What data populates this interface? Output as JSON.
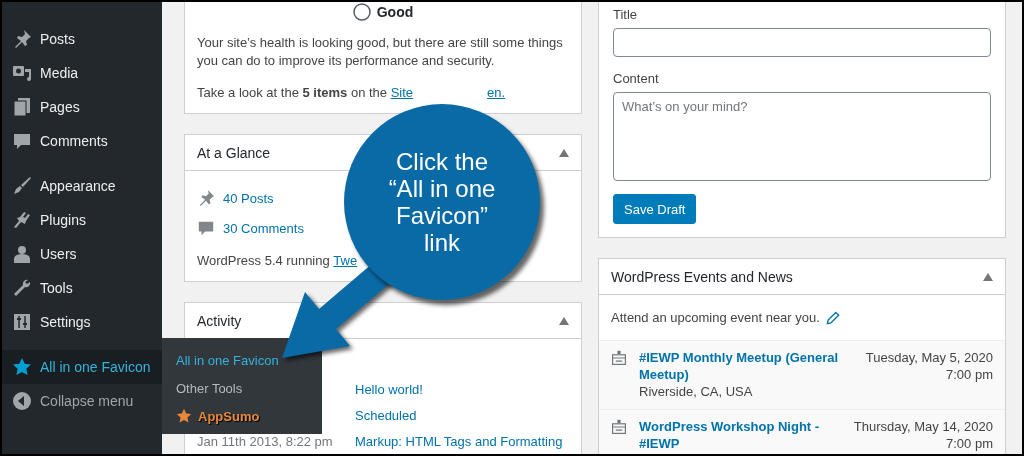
{
  "sidebar": {
    "groups": [
      {
        "items": [
          {
            "label": "Posts",
            "selected": false
          },
          {
            "label": "Media",
            "selected": false
          },
          {
            "label": "Pages",
            "selected": false
          },
          {
            "label": "Comments",
            "selected": false
          }
        ]
      },
      {
        "items": [
          {
            "label": "Appearance",
            "selected": false
          },
          {
            "label": "Plugins",
            "selected": false
          },
          {
            "label": "Users",
            "selected": false
          },
          {
            "label": "Tools",
            "selected": false
          },
          {
            "label": "Settings",
            "selected": false
          }
        ]
      },
      {
        "items": [
          {
            "label": "All in one Favicon",
            "selected": true
          }
        ]
      }
    ],
    "collapse": "Collapse menu"
  },
  "flyout": {
    "items": [
      {
        "label": "All in one Favicon",
        "kind": "current"
      },
      {
        "label": "Other Tools",
        "kind": "plain"
      },
      {
        "label": "AppSumo",
        "kind": "promo"
      }
    ]
  },
  "site_health": {
    "status": "Good",
    "message": "Your site’s health is looking good, but there are still some things you can do to improve its performance and security.",
    "tip": "Take a look at the **5 items** on the",
    "tip_link": "Site",
    "tip_end": "en."
  },
  "at_a_glance": {
    "title": "At a Glance",
    "expanded": true,
    "stats": [
      "40 Posts",
      "30 Comments"
    ],
    "version_text": "WordPress 5.4 running",
    "theme_link": "Twe"
  },
  "activity": {
    "title": "Activity",
    "expanded": true,
    "rows": [
      {
        "title": "Hello world!"
      },
      {
        "title": "Scheduled"
      },
      {
        "date": "Jan 11th 2013, 8:22 pm",
        "title": "Markup: HTML Tags and Formatting"
      }
    ]
  },
  "quick_draft": {
    "title_label": "Title",
    "content_label": "Content",
    "content_placeholder": "What’s on your mind?",
    "save_button": "Save Draft"
  },
  "events": {
    "title": "WordPress Events and News",
    "expanded": true,
    "intro": "Attend an upcoming event near you.",
    "items": [
      {
        "name": "#IEWP Monthly Meetup (General Meetup)",
        "location": "Riverside, CA, USA",
        "date": "Tuesday, May 5, 2020",
        "time": "7:00 pm"
      },
      {
        "name": "WordPress Workshop Night - #IEWP",
        "date": "Thursday, May 14, 2020",
        "time": "7:00 pm"
      }
    ]
  },
  "callout": {
    "text": "Click the “All in one Favicon” link"
  }
}
